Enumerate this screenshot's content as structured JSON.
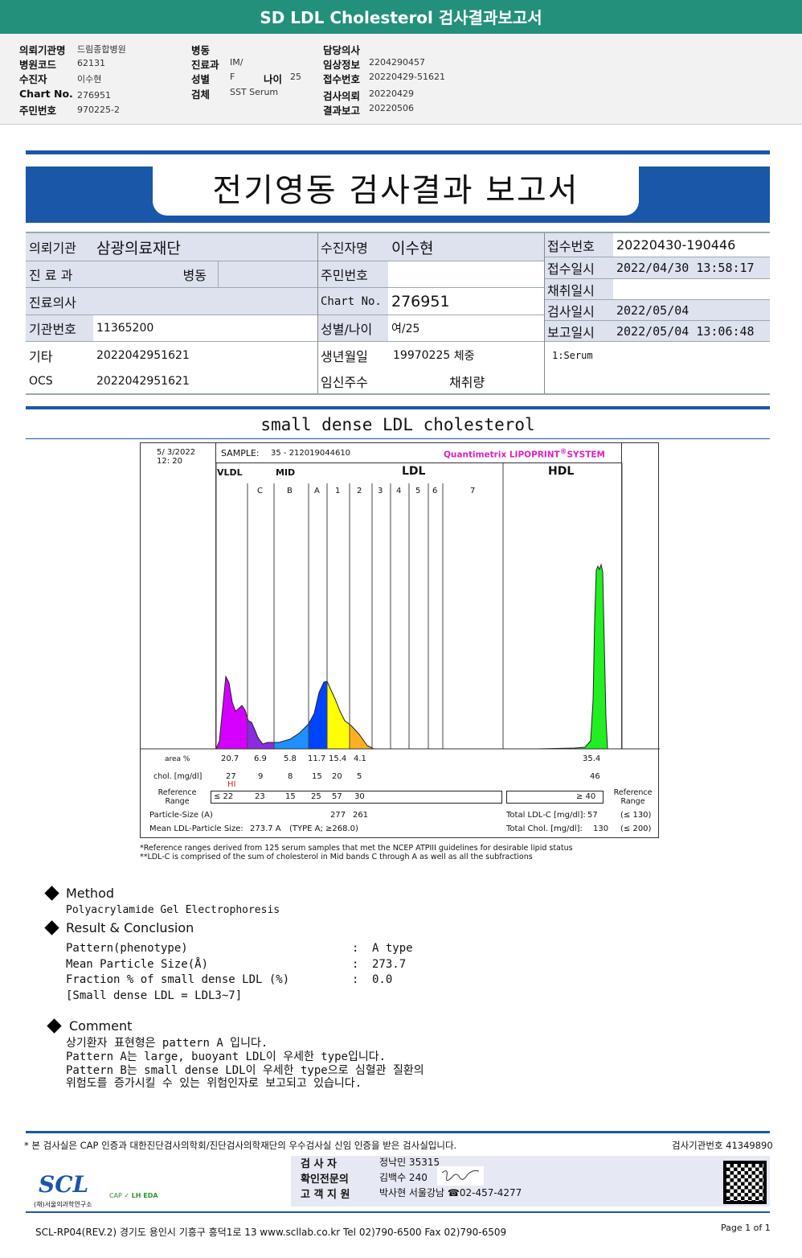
{
  "title": "SD LDL Cholesterol 검사결과보고서",
  "info": {
    "col1": [
      {
        "label": "의뢰기관명",
        "value": "드림종합병원"
      },
      {
        "label": "병원코드",
        "value": "62131"
      },
      {
        "label": "수진자",
        "value": "이수현"
      },
      {
        "label": "Chart No.",
        "value": "276951"
      },
      {
        "label": "주민번호",
        "value": "970225-2"
      }
    ],
    "col2": [
      {
        "label": "병동",
        "value": ""
      },
      {
        "label": "진료과",
        "value": "IM/"
      },
      {
        "label": "성별",
        "value": "F"
      },
      {
        "label": "검체",
        "value": "SST Serum"
      }
    ],
    "age_label": "나이",
    "age": "25",
    "col3": [
      {
        "label": "담당의사",
        "value": ""
      },
      {
        "label": "임상정보",
        "value": "2204290457"
      },
      {
        "label": "접수번호",
        "value": "20220429-51621"
      },
      {
        "label": "검사의뢰",
        "value": "20220429"
      },
      {
        "label": "결과보고",
        "value": "20220506"
      }
    ]
  },
  "report_title": "전기영동 검사결과 보고서",
  "table": {
    "inst_label": "의뢰기관",
    "inst": "삼광의료재단",
    "name_label": "수진자명",
    "name": "이수현",
    "dept_label": "진 료 과",
    "ward_label": "병동",
    "rrn_label": "주민번호",
    "rrn": "",
    "doctor_label": "진료의사",
    "doctor": "",
    "chart_label": "Chart No.",
    "chart": "276951",
    "instno_label": "기관번호",
    "instno": "11365200",
    "sexage_label": "성별/나이",
    "sexage": "여/25",
    "etc_label": "기타",
    "etc": "2022042951621",
    "ocs_label": "OCS",
    "ocs": "2022042951621",
    "dob_label": "생년월일",
    "dob": "19970225",
    "weight_label": "체중",
    "preg_label": "임신주수",
    "volume_label": "채취량",
    "recno_label": "접수번호",
    "recno": "20220430-190446",
    "recdate_label": "접수일시",
    "recdate": "2022/04/30 13:58:17",
    "colldate_label": "채취일시",
    "colldate": "",
    "testdate_label": "검사일시",
    "testdate": "2022/05/04",
    "repdate_label": "보고일시",
    "repdate": "2022/05/04 13:06:48",
    "specimen": "1:Serum"
  },
  "section_title": "small dense LDL cholesterol",
  "lipoprint": {
    "date": "5/  3/2022",
    "time": "12:  20",
    "sample_label": "SAMPLE:",
    "sample": "35 - 212019044610",
    "brand": "Quantimetrix LIPOPRINT",
    "brand2": "SYSTEM",
    "brand_color": "#e020c0",
    "groups": [
      "VLDL",
      "MID",
      "LDL",
      "HDL"
    ],
    "bands": [
      "C",
      "B",
      "A",
      "1",
      "2",
      "3",
      "4",
      "5",
      "6",
      "7"
    ],
    "band_colors": {
      "vldl": "#d400ff",
      "midc": "#8a2be2",
      "midb": "#1e90ff",
      "mida": "#0044ff",
      "ldl1": "#ffff00",
      "ldl2": "#ffb020",
      "hdl": "#22ee22"
    },
    "area_label": "area %",
    "area": [
      "20.7",
      "6.9",
      "5.8",
      "11.7",
      "15.4",
      "4.1"
    ],
    "area_hdl": "35.4",
    "chol_label": "chol. [mg/dl]",
    "chol": [
      "27",
      "9",
      "8",
      "15",
      "20",
      "5"
    ],
    "chol_hdl": "46",
    "hi_flag": "HI",
    "ref_label": "Reference Range",
    "ref": [
      "≤ 22",
      "23",
      "15",
      "25",
      "57",
      "30"
    ],
    "ref_hdl": "≥  40",
    "psize_label": "Particle-Size (A)",
    "psize": [
      "277",
      "261"
    ],
    "mean_label": "Mean LDL-Particle Size:",
    "mean": "273.7  A",
    "mean_type": "(TYPE A; ≥268.0)",
    "tldl_label": "Total LDL-C [mg/dl]:",
    "tldl": "57",
    "tldl_ref": "(≤ 130)",
    "tchol_label": "Total Chol. [mg/dl]:",
    "tchol": "130",
    "tchol_ref": "(≤ 200)",
    "note1": "*Reference ranges derived from 125 serum samples that met the NCEP ATPIII guidelines for desirable lipid status",
    "note2": "**LDL-C is comprised of the sum of cholesterol in Mid bands C through A as well as all the subfractions"
  },
  "method": {
    "title": "Method",
    "text": "Polyacrylamide Gel Electrophoresis"
  },
  "result": {
    "title": "Result & Conclusion",
    "rows": [
      {
        "k": "Pattern(phenotype)",
        "v": "A type"
      },
      {
        "k": "Mean Particle Size(Å)",
        "v": "273.7"
      },
      {
        "k": "Fraction % of small dense LDL (%)",
        "v": "0.0"
      }
    ],
    "note": "[Small dense LDL = LDL3~7]"
  },
  "comment": {
    "title": "Comment",
    "lines": [
      "상기환자 표현형은 pattern A 입니다.",
      "Pattern A는 large, buoyant LDL이 우세한 type입니다.",
      "Pattern B는 small dense LDL이 우세한 type으로 심혈관 질환의",
      "위험도를 증가시킬 수 있는 위험인자로 보고되고 있습니다."
    ]
  },
  "footer": {
    "cert": "* 본 검사실은 CAP 인증과 대한진단검사의학회/진단검사의학재단의 우수검사실 신임 인증을 받은 검사실입니다.",
    "labno": "검사기관번호 41349890",
    "tester_label": "검   사   자",
    "tester": "정낙민 35315",
    "confirm_label": "확인전문의",
    "confirm": "김백수 240",
    "support_label": "고 객 지 원",
    "support": "박사현 서울강남 ☎02-457-4277",
    "logo": "SCL",
    "logo_sub": "(재)서울의과학연구소",
    "address": "SCL-RP04(REV.2)  경기도 용인시 기흥구 흥덕1로 13  www.scllab.co.kr  Tel 02)790-6500  Fax 02)790-6509",
    "page": "Page 1 of 1"
  }
}
